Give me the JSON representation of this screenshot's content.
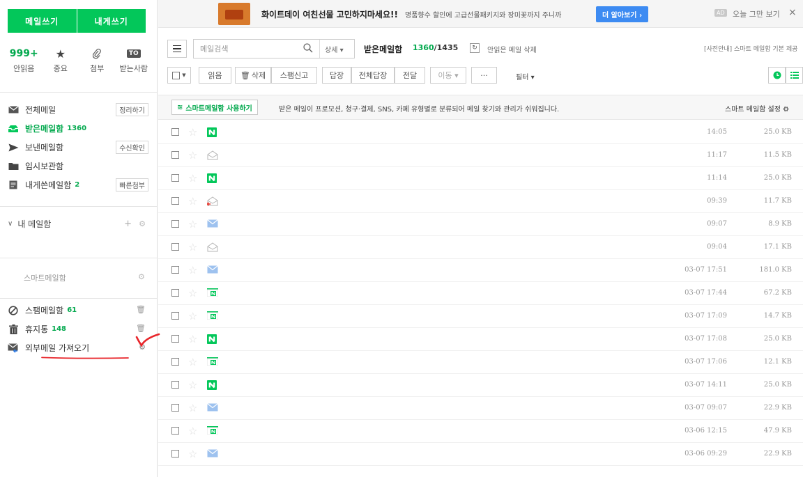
{
  "compose": {
    "write": "메일쓰기",
    "self": "내게쓰기"
  },
  "quick": [
    {
      "top": "999+",
      "label": "안읽음",
      "icon": "unread-count"
    },
    {
      "top": "★",
      "label": "중요",
      "icon": "star-icon"
    },
    {
      "top": "⌂",
      "label": "첨부",
      "icon": "attachment-icon"
    },
    {
      "top": "TO",
      "label": "받는사람",
      "icon": "to-icon"
    }
  ],
  "folders": [
    {
      "label": "전체메일",
      "icon": "envelope-icon",
      "button": "정리하기"
    },
    {
      "label": "받은메일함",
      "count": "1360",
      "icon": "inbox-icon",
      "active": true
    },
    {
      "label": "보낸메일함",
      "icon": "send-icon",
      "button": "수신확인"
    },
    {
      "label": "임시보관함",
      "icon": "folder-icon"
    },
    {
      "label": "내게쓴메일함",
      "count": "2",
      "icon": "memo-icon",
      "button": "빠른첨부"
    }
  ],
  "my_mail": "내 메일함",
  "smart_mailbox": "스마트메일함",
  "extra": [
    {
      "label": "스팸메일함",
      "count": "61",
      "icon": "block-icon"
    },
    {
      "label": "휴지통",
      "count": "148",
      "icon": "trash-icon"
    },
    {
      "label": "외부메일 가져오기",
      "icon": "import-mail-icon"
    }
  ],
  "ad": {
    "title": "화이트데이 여친선물 고민하지마세요!!",
    "sub": "명품향수 할인에 고급선물패키지와 장미꽃까지 주니까",
    "button": "더 알아보기 ›",
    "badge": "AD",
    "close_text": "오늘 그만 보기",
    "close": "×"
  },
  "toolbar": {
    "search_placeholder": "메일검색",
    "detail": "상세 ▾",
    "inbox_title": "받은메일함",
    "unread": "1360",
    "total": "/1435",
    "delete_unsafe": "안읽은 메일 삭제",
    "notice": "[사전안내] 스마트 메일함 기본 제공",
    "read": "읽음",
    "delete": "삭제",
    "spam": "스팸신고",
    "reply": "답장",
    "reply_all": "전체답장",
    "forward": "전달",
    "move": "이동 ▾",
    "more": "···",
    "filter": "필터 ▾"
  },
  "smartbar": {
    "button": "스마트메일함 사용하기",
    "desc": "받은 메일이 프로모션, 청구·결제, SNS, 카페 유형별로 분류되어 메일 찾기와 관리가 쉬워집니다.",
    "setting": "스마트 메일함 설정 ⚙"
  },
  "mails": [
    {
      "icon": "naver-n",
      "time": "14:05",
      "size": "25.0 KB"
    },
    {
      "icon": "envelope-open",
      "time": "11:17",
      "size": "11.5 KB"
    },
    {
      "icon": "naver-n",
      "time": "11:14",
      "size": "25.0 KB"
    },
    {
      "icon": "envelope-open-reply",
      "time": "09:39",
      "size": "11.7 KB"
    },
    {
      "icon": "envelope-blue",
      "time": "09:07",
      "size": "8.9 KB"
    },
    {
      "icon": "envelope-open",
      "time": "09:04",
      "size": "17.1 KB"
    },
    {
      "icon": "envelope-blue",
      "time": "03-07 17:51",
      "size": "181.0 KB"
    },
    {
      "icon": "naver-n-calendar",
      "time": "03-07 17:44",
      "size": "67.2 KB"
    },
    {
      "icon": "naver-n-calendar",
      "time": "03-07 17:09",
      "size": "14.7 KB"
    },
    {
      "icon": "naver-n",
      "time": "03-07 17:08",
      "size": "25.0 KB"
    },
    {
      "icon": "naver-n-calendar",
      "time": "03-07 17:06",
      "size": "12.1 KB"
    },
    {
      "icon": "naver-n",
      "time": "03-07 14:11",
      "size": "25.0 KB"
    },
    {
      "icon": "envelope-blue",
      "time": "03-07 09:07",
      "size": "22.9 KB"
    },
    {
      "icon": "naver-n-calendar",
      "time": "03-06 12:15",
      "size": "47.9 KB"
    },
    {
      "icon": "envelope-blue",
      "time": "03-06 09:29",
      "size": "22.9 KB"
    }
  ],
  "colors": {
    "brand": "#03c75a",
    "accent_text": "#03a94e",
    "ad_button": "#3d8bf2",
    "annotation_red": "#e8252a"
  }
}
